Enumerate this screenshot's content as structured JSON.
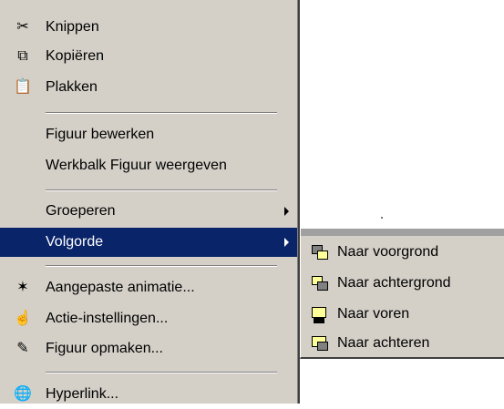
{
  "context_menu": {
    "items": [
      {
        "label": "Knippen",
        "icon": "scissors-icon"
      },
      {
        "label": "Kopiëren",
        "icon": "copy-icon"
      },
      {
        "label": "Plakken",
        "icon": "paste-icon"
      },
      {
        "label": "Figuur bewerken"
      },
      {
        "label": "Werkbalk Figuur weergeven"
      },
      {
        "label": "Groeperen",
        "has_submenu": true
      },
      {
        "label": "Volgorde",
        "has_submenu": true,
        "selected": true
      },
      {
        "label": "Aangepaste animatie...",
        "icon": "animation-icon"
      },
      {
        "label": "Actie-instellingen...",
        "icon": "action-icon"
      },
      {
        "label": "Figuur opmaken...",
        "icon": "format-icon"
      },
      {
        "label": "Hyperlink...",
        "icon": "hyperlink-icon"
      }
    ]
  },
  "submenu_volgorde": {
    "items": [
      {
        "label": "Naar voorgrond",
        "icon": "bring-to-front-icon"
      },
      {
        "label": "Naar achtergrond",
        "icon": "send-to-back-icon"
      },
      {
        "label": "Naar voren",
        "icon": "bring-forward-icon"
      },
      {
        "label": "Naar achteren",
        "icon": "send-backward-icon"
      }
    ]
  },
  "colors": {
    "menu_bg": "#d4d0c8",
    "highlight": "#0a246a",
    "highlight_text": "#ffffff"
  }
}
